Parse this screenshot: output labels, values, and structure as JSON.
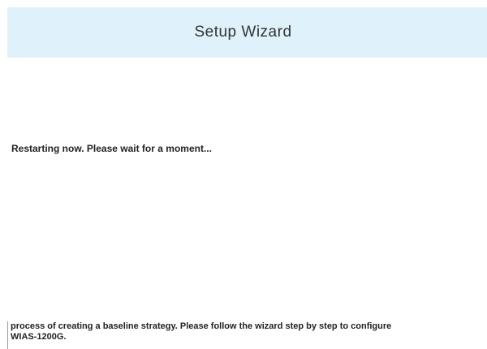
{
  "header": {
    "title": "Setup Wizard"
  },
  "main": {
    "status_text": "Restarting now. Please wait for a moment..."
  },
  "footer": {
    "line1": "process of creating a baseline strategy. Please follow the wizard step by step to configure",
    "line2": "WIAS-1200G."
  },
  "colors": {
    "header_background": "#dff1fb",
    "page_background": "#ffffff"
  }
}
